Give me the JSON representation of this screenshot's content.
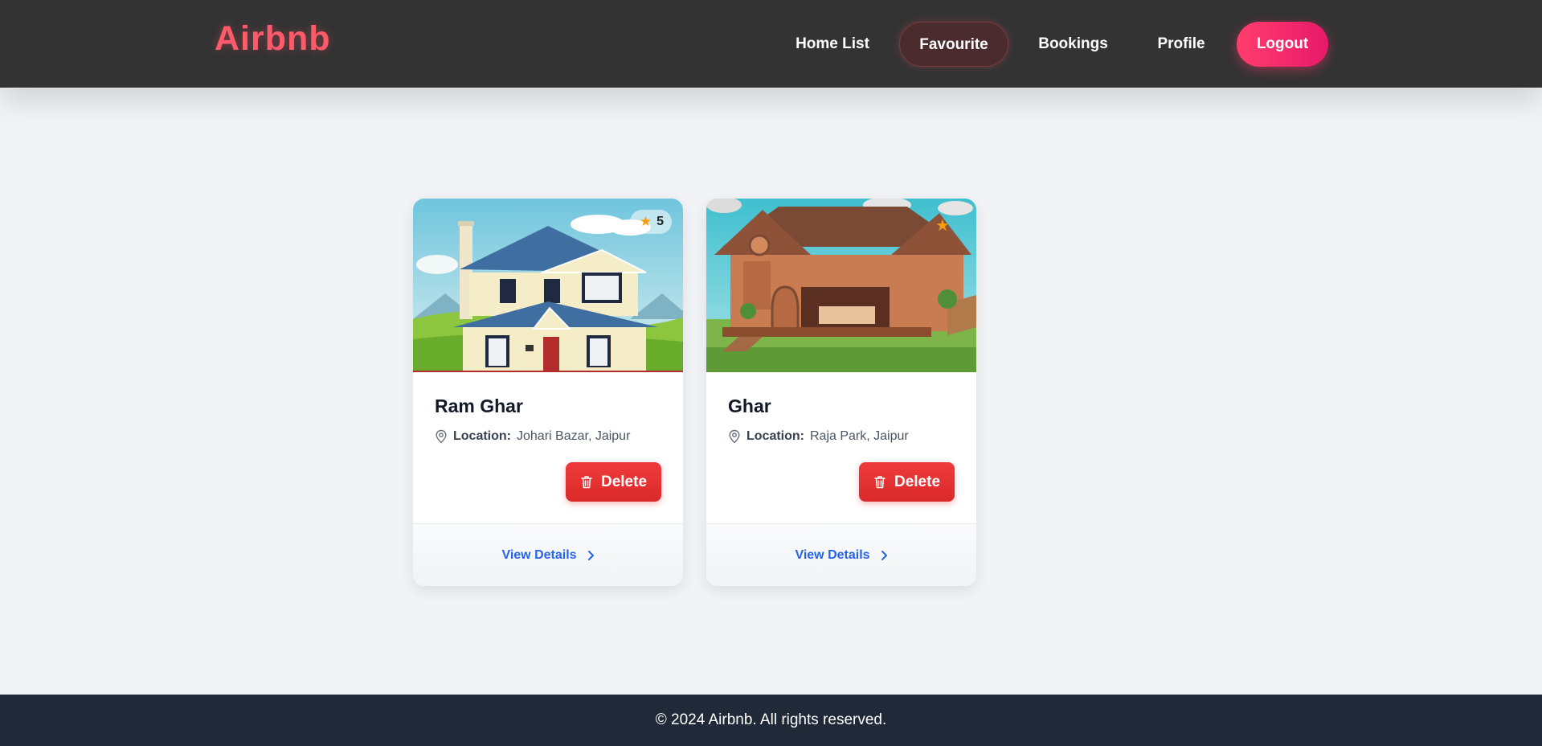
{
  "nav": {
    "brand": "Airbnb",
    "links": [
      "Home List",
      "Favourite",
      "Bookings",
      "Profile"
    ],
    "logout": "Logout"
  },
  "favourites": [
    {
      "title": "Ram Ghar",
      "location_label": "Location:",
      "location": "Johari Bazar, Jaipur",
      "rating": "5",
      "delete_label": "Delete",
      "details_label": "View Details"
    },
    {
      "title": "Ghar",
      "location_label": "Location:",
      "location": "Raja Park, Jaipur",
      "rating": "",
      "delete_label": "Delete",
      "details_label": "View Details"
    }
  ],
  "footer": {
    "text": "© 2024 Airbnb. All rights reserved."
  },
  "colors": {
    "navbar": "#333333",
    "brand": "#ff5a6a",
    "logout": "#ff3d6c",
    "delete": "#e53535",
    "link": "#2563eb",
    "footer": "#1f2937",
    "page_bg": "#f1f3f6"
  },
  "icons": [
    "star-icon",
    "map-pin-icon",
    "trash-icon",
    "chevron-right-icon"
  ]
}
